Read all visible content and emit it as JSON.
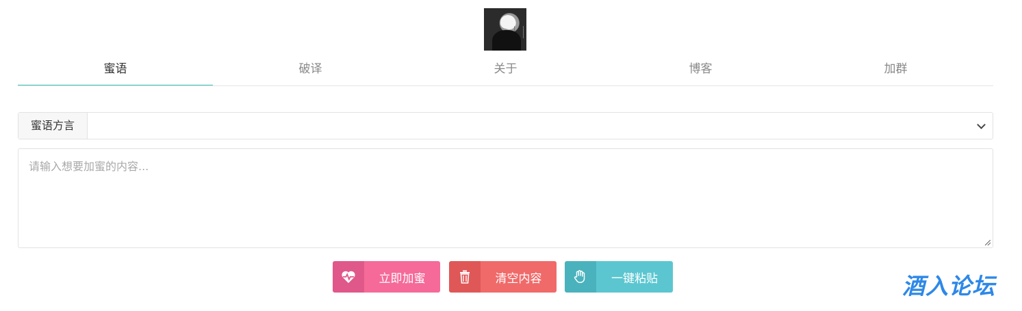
{
  "avatar": {
    "icon": "profile-avatar"
  },
  "tabs": [
    {
      "label": "蜜语",
      "active": true
    },
    {
      "label": "破译",
      "active": false
    },
    {
      "label": "关于",
      "active": false
    },
    {
      "label": "博客",
      "active": false
    },
    {
      "label": "加群",
      "active": false
    }
  ],
  "dialect": {
    "label": "蜜语方言",
    "selected": ""
  },
  "input": {
    "placeholder": "请输入想要加蜜的内容..."
  },
  "buttons": {
    "encrypt": {
      "label": "立即加蜜",
      "icon": "heart-pulse-icon"
    },
    "clear": {
      "label": "清空内容",
      "icon": "trash-icon"
    },
    "paste": {
      "label": "一键粘贴",
      "icon": "hand-icon"
    }
  },
  "watermark": "酒入论坛",
  "colors": {
    "accent": "#3cc0b5",
    "encrypt": "#f56a98",
    "clear": "#f06a6a",
    "paste": "#5bc6d0",
    "watermark": "#2e88e8"
  }
}
